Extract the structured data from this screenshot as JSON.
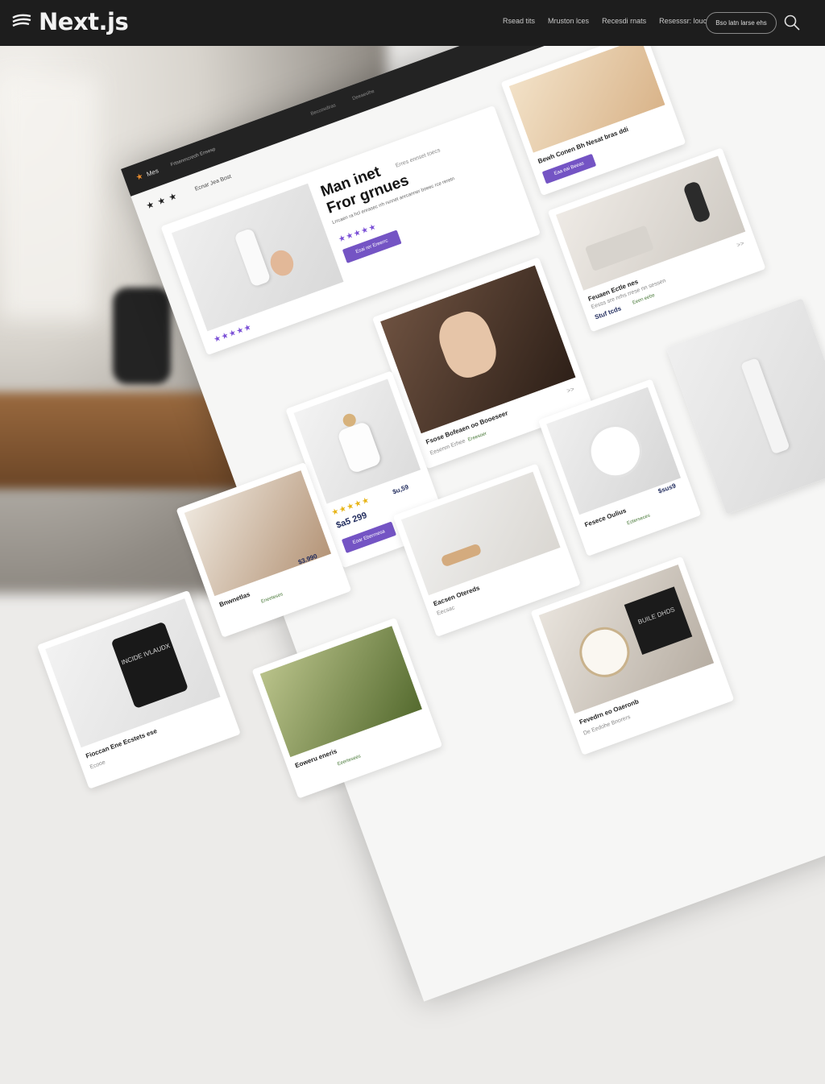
{
  "app": {
    "logo_text": "Next.js"
  },
  "nav": {
    "links": [
      "Rsead tits",
      "Mruston lces",
      "Recesdi rnats",
      "Resesssr: louc"
    ],
    "cta_label": "Bso latn larse ehs"
  },
  "icons": [
    "nextjs-logo-icon",
    "search-icon",
    "star-icon",
    "chevron-right-icon"
  ],
  "colors": {
    "accent": "#7454c4",
    "topbar": "#1d1d1d",
    "star_yellow": "#e7b416",
    "price_text": "#1f2a5c"
  },
  "mockup": {
    "header": {
      "brand": "Mes",
      "tagline": "Frtsenmcreoh Ensesp",
      "nav_center": [
        "Beccosdiras",
        "Deeaeslhe"
      ],
      "subtitle": "Ecnar Jea Bost"
    },
    "hero": {
      "title_line1": "Man inet",
      "title_line2": "Fror grnues",
      "description": "Lrrcaen ra hcl enrasec rrh rsnnet anrcanner boeec rce reretn",
      "button": "Esai rer Ereerrc",
      "side_note": "Erres ennset toecs"
    },
    "cards": [
      {
        "title": "Bewh Conen Bh Nesat bras ddi",
        "button": "Eaa eai Beeas"
      },
      {
        "title": "Feuaen Ectle nes",
        "meta": "Eesss sre nrhs rrese nn sessen",
        "price": "Stuf tcds",
        "tag": "Eeen eebe"
      },
      {
        "title": "Fsose Bofeaen oo Booeseer",
        "meta": "Eesenm Erhee",
        "tag": "Ereesoer"
      },
      {
        "price_main": "$a5 299",
        "price_small": "$u,59",
        "button": "Eoar Eberrnesa"
      },
      {
        "title": "Bnwnetlas",
        "price": "$3.990",
        "tag": "Eneeteses"
      },
      {
        "title": "Eacsen Otereds",
        "meta": "Eecsac"
      },
      {
        "title": "Fesece Oulius",
        "price": "$sus9",
        "tag": "Eoterseces"
      },
      {
        "title": "Fioccan Ene Ecstets ese",
        "meta": "Ecooe"
      },
      {
        "title": "Eoweru eneris",
        "tag": "Eeertesees"
      },
      {
        "title": "Fevedrn eo Oaeronb",
        "meta": "De Eedohe Bnorers"
      }
    ],
    "mug_text": "INCIDE IVLAUDX",
    "pillow_text": "BUILE DHDS"
  }
}
